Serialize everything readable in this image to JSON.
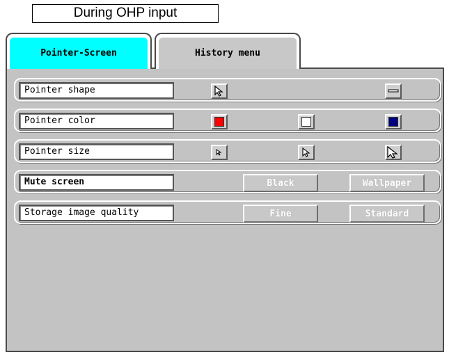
{
  "caption": "During OHP input",
  "tabs": [
    {
      "label": "Pointer-Screen",
      "active": true
    },
    {
      "label": "History menu",
      "active": false
    }
  ],
  "rows": [
    {
      "label": "Pointer shape"
    },
    {
      "label": "Pointer color",
      "swatches": [
        "#ff0000",
        "#ffffff",
        "#000080"
      ]
    },
    {
      "label": "Pointer size"
    },
    {
      "label": "Mute screen",
      "options": [
        "Black",
        "Wallpaper"
      ]
    },
    {
      "label": "Storage image quality",
      "options": [
        "Fine",
        "Standard"
      ]
    }
  ],
  "icons": {
    "pointer_shape": [
      "arrow-pointer-icon",
      "bar-pointer-icon"
    ],
    "pointer_size": [
      "small-arrow-icon",
      "medium-arrow-icon",
      "large-arrow-icon"
    ]
  },
  "colors": {
    "active_tab": "#00ffff",
    "panel": "#c3c3c3"
  }
}
